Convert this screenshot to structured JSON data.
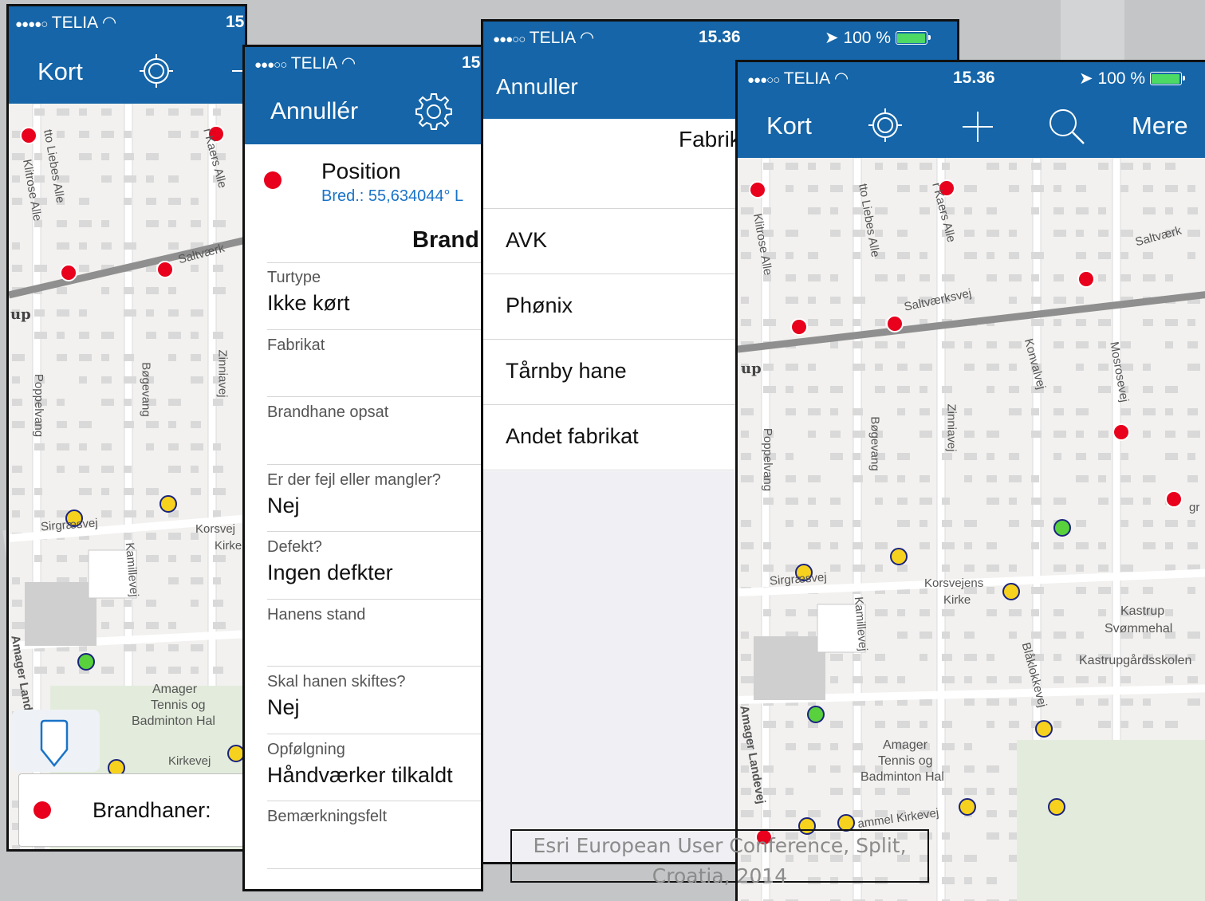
{
  "status_bar": {
    "carrier": "TELIA",
    "signal_full": "●●●●○",
    "signal_partial": "●●●○○",
    "time": "15.36",
    "battery": "100 %"
  },
  "screen_map_left": {
    "nav_title": "Kort",
    "legend_label": "Brandhaner:"
  },
  "screen_form": {
    "cancel": "Annullér",
    "position_title": "Position",
    "position_value": "Bred.: 55,634044° L",
    "section_title": "Brand",
    "fields": [
      {
        "label": "Turtype",
        "value": "Ikke kørt"
      },
      {
        "label": "Fabrikat",
        "value": ""
      },
      {
        "label": "Brandhane opsat",
        "value": ""
      },
      {
        "label": "Er der fejl eller mangler?",
        "value": "Nej"
      },
      {
        "label": "Defekt?",
        "value": "Ingen defkter"
      },
      {
        "label": "Hanens stand",
        "value": ""
      },
      {
        "label": "Skal hanen skiftes?",
        "value": "Nej"
      },
      {
        "label": "Opfølgning",
        "value": "Håndværker tilkaldt"
      },
      {
        "label": "Bemærkningsfelt",
        "value": ""
      }
    ]
  },
  "screen_picker": {
    "cancel": "Annuller",
    "title": "Fabrik",
    "options": [
      "AVK",
      "Phønix",
      "Tårnby hane",
      "Andet fabrikat"
    ]
  },
  "screen_map_right": {
    "nav_title": "Kort",
    "more": "Mere"
  },
  "map_labels": {
    "liebes": "tto Liebes Alle",
    "klitrose": "Klitrose Alle",
    "kaers": "r Kaers Alle",
    "saltvaerks": "Saltværksvej",
    "saltvaerks_short": "Saltværk",
    "up": "up",
    "poppel": "Poppelvang",
    "boge": "Bøgevang",
    "zinnia": "Zinniavej",
    "konval": "Konvalvej",
    "mosrose": "Mosrosevej",
    "sirgraes": "Sirgræsvej",
    "kamille": "Kamillevej",
    "korsvejens": "Korsvejens",
    "korsvej_short": "Korsvej",
    "kirke": "Kirke",
    "kirke_short": "Kirke",
    "kastrup": "Kastrup",
    "svommehal": "Svømmehal",
    "kastrupgaard": "Kastrupgårdsskolen",
    "amager": "Amager",
    "tennis": "Tennis og",
    "badminton": "Badminton Hal",
    "amager_lv": "Amager Landevej",
    "kirkevej": "Kirkevej",
    "kirkevej_long": "ammel Kirkevej",
    "blaklokke": "Blåklokkevej",
    "gras": "gr"
  },
  "caption": {
    "line1": "Esri European User Conference, Split,",
    "line2": "Croatia, 2014"
  },
  "colors": {
    "nav_blue": "#1565a8",
    "hydrant_red": "#e8001c",
    "hydrant_yellow": "#f6d21e",
    "hydrant_green": "#58d13c",
    "link_blue": "#1a73c8"
  }
}
